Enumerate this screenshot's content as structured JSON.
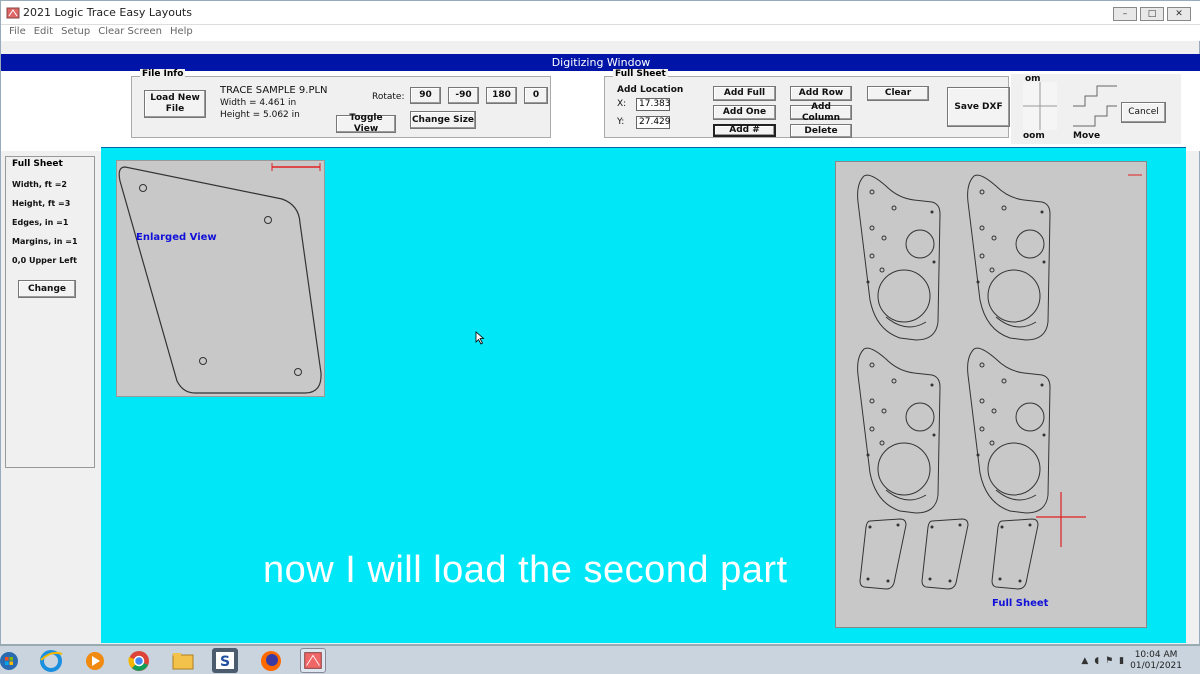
{
  "window": {
    "title": "2021 Logic Trace Easy Layouts",
    "controls": [
      "–",
      "□",
      "✕"
    ]
  },
  "menu": [
    "File",
    "Edit",
    "Setup",
    "Clear Screen",
    "Help"
  ],
  "digitizing_title": "Digitizing Window",
  "file_info": {
    "legend": "File Info",
    "load_button": "Load New File",
    "filename": "TRACE SAMPLE 9.PLN",
    "width_label": "Width =  4.461 in",
    "height_label": "Height =  5.062 in",
    "rotate_label": "Rotate:",
    "rotate_buttons": [
      "90",
      "-90",
      "180",
      "0"
    ],
    "toggle_view": "Toggle View",
    "change_size": "Change Size"
  },
  "full_sheet_group": {
    "legend": "Full Sheet",
    "add_location_label": "Add Location",
    "x_label": "X:",
    "x_value": "17.383",
    "y_label": "Y:",
    "y_value": "27.429",
    "add_full": "Add Full",
    "add_one": "Add One",
    "add_hash": "Add #",
    "add_row": "Add Row",
    "add_column": "Add Column",
    "delete": "Delete",
    "clear": "Clear",
    "save_dxf": "Save DXF"
  },
  "zoom": {
    "legend_partial": "om",
    "zoom_label_partial": "oom",
    "move_label": "Move",
    "cancel": "Cancel"
  },
  "sidebar": {
    "legend": "Full Sheet",
    "lines": [
      "Width, ft =2",
      "Height, ft =3",
      "Edges, in =1",
      "Margins, in =1",
      "0,0 Upper Left"
    ],
    "change_button": "Change"
  },
  "views": {
    "enlarged_label": "Enlarged View",
    "full_label": "Full Sheet"
  },
  "subtitle": "now I will load the second part",
  "taskbar": {
    "time": "10:04 AM",
    "date": "01/01/2021"
  },
  "colors": {
    "canvas": "#00e8f8",
    "title_bar": "#0014a8",
    "view_label": "#1010d8",
    "cursor_cross": "#e02020"
  }
}
